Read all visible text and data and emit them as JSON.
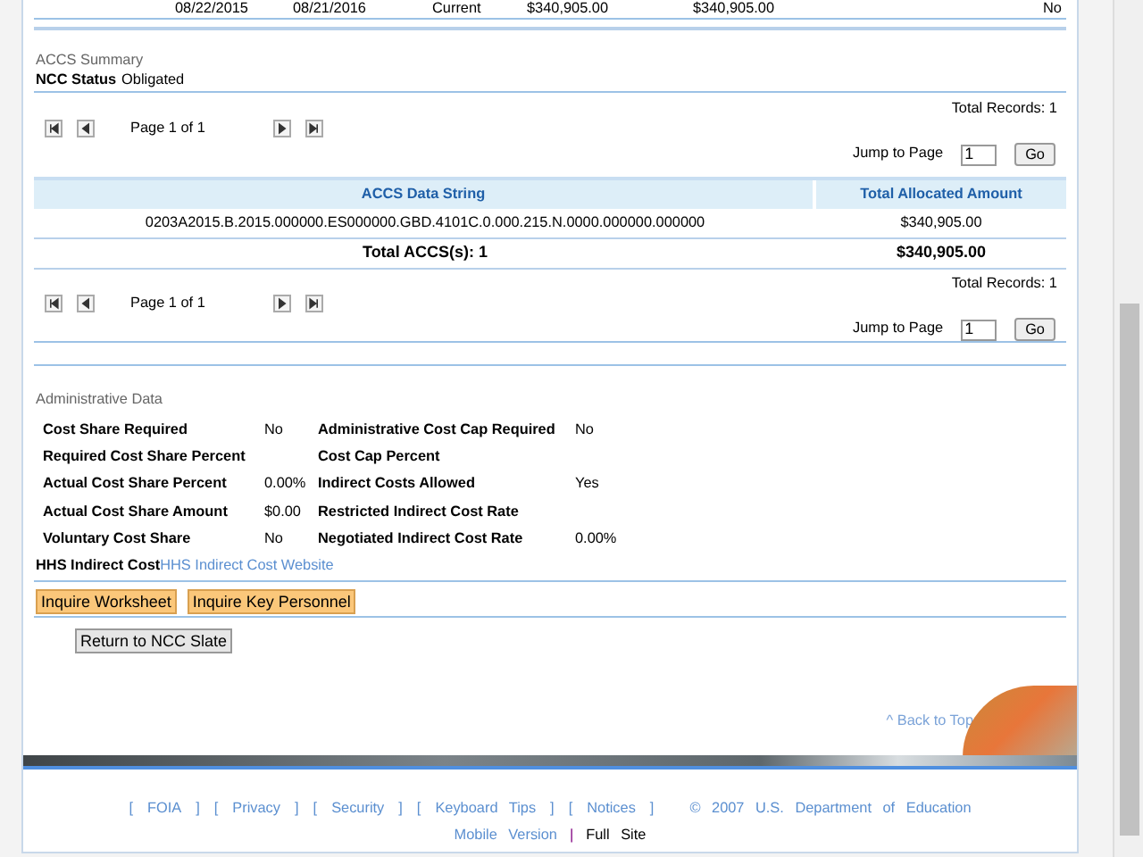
{
  "top_row": [
    "08/22/2015",
    "08/21/2016",
    "Current",
    "$340,905.00",
    "$340,905.00",
    "No"
  ],
  "accs_summary": {
    "title": "ACCS Summary",
    "status_label": "NCC Status",
    "status_value": "Obligated",
    "pagers": [
      {
        "total_records": "Total Records: 1",
        "page_label": "Page 1 of 1",
        "jump_label": "Jump to Page",
        "jump_value": "1",
        "go": "Go"
      },
      {
        "total_records": "Total Records: 1",
        "page_label": "Page 1 of 1",
        "jump_label": "Jump to Page",
        "jump_value": "1",
        "go": "Go"
      }
    ],
    "table": {
      "columns": [
        "ACCS Data String",
        "Total Allocated Amount"
      ],
      "rows": [
        [
          "0203A2015.B.2015.000000.ES000000.GBD.4101C.0.000.215.N.0000.000000.000000",
          "$340,905.00"
        ]
      ],
      "total": [
        "Total ACCS(s): 1",
        "$340,905.00"
      ]
    }
  },
  "administrative_data": {
    "title": "Administrative Data",
    "rows": [
      {
        "label": "Cost Share Required",
        "value": "No",
        "label_2": "Administrative Cost Cap Required",
        "value_2": "No"
      },
      {
        "label": "Required Cost Share Percent",
        "value": "",
        "label_2": "Cost Cap Percent",
        "value_2": ""
      },
      {
        "label": "Actual Cost Share Percent",
        "value": "0.00%",
        "label_2": "Indirect Costs Allowed",
        "value_2": "Yes"
      },
      {
        "label": "Actual Cost Share Amount",
        "value": "$0.00",
        "label_2": "Restricted Indirect Cost Rate",
        "value_2": ""
      },
      {
        "label": "Voluntary Cost Share",
        "value": "No",
        "label_2": "Negotiated Indirect Cost Rate",
        "value_2": "0.00%"
      }
    ],
    "hhs_label": "HHS Indirect Cost",
    "hhs_link": "HHS Indirect Cost Website"
  },
  "action_buttons": [
    "Inquire Worksheet",
    "Inquire Key Personnel"
  ],
  "return_button": "Return to NCC Slate",
  "back_to_top": "^ Back to Top",
  "footer": {
    "items": [
      {
        "kind": "bracket",
        "text": "["
      },
      {
        "kind": "link",
        "text": "FOIA"
      },
      {
        "kind": "bracket",
        "text": "]"
      },
      {
        "kind": "bracket",
        "text": "["
      },
      {
        "kind": "link",
        "text": "Privacy"
      },
      {
        "kind": "bracket",
        "text": "]"
      },
      {
        "kind": "bracket",
        "text": "["
      },
      {
        "kind": "link",
        "text": "Security"
      },
      {
        "kind": "bracket",
        "text": "]"
      },
      {
        "kind": "bracket",
        "text": "["
      },
      {
        "kind": "link",
        "text": "Keyboard Tips"
      },
      {
        "kind": "bracket",
        "text": "]"
      },
      {
        "kind": "bracket",
        "text": "["
      },
      {
        "kind": "link",
        "text": "Notices"
      },
      {
        "kind": "bracket",
        "text": "]"
      },
      {
        "kind": "text",
        "text": "© 2007 U.S. Department of Education"
      }
    ],
    "mobile": "Mobile Version",
    "separator": "|",
    "full_site": "Full Site"
  }
}
